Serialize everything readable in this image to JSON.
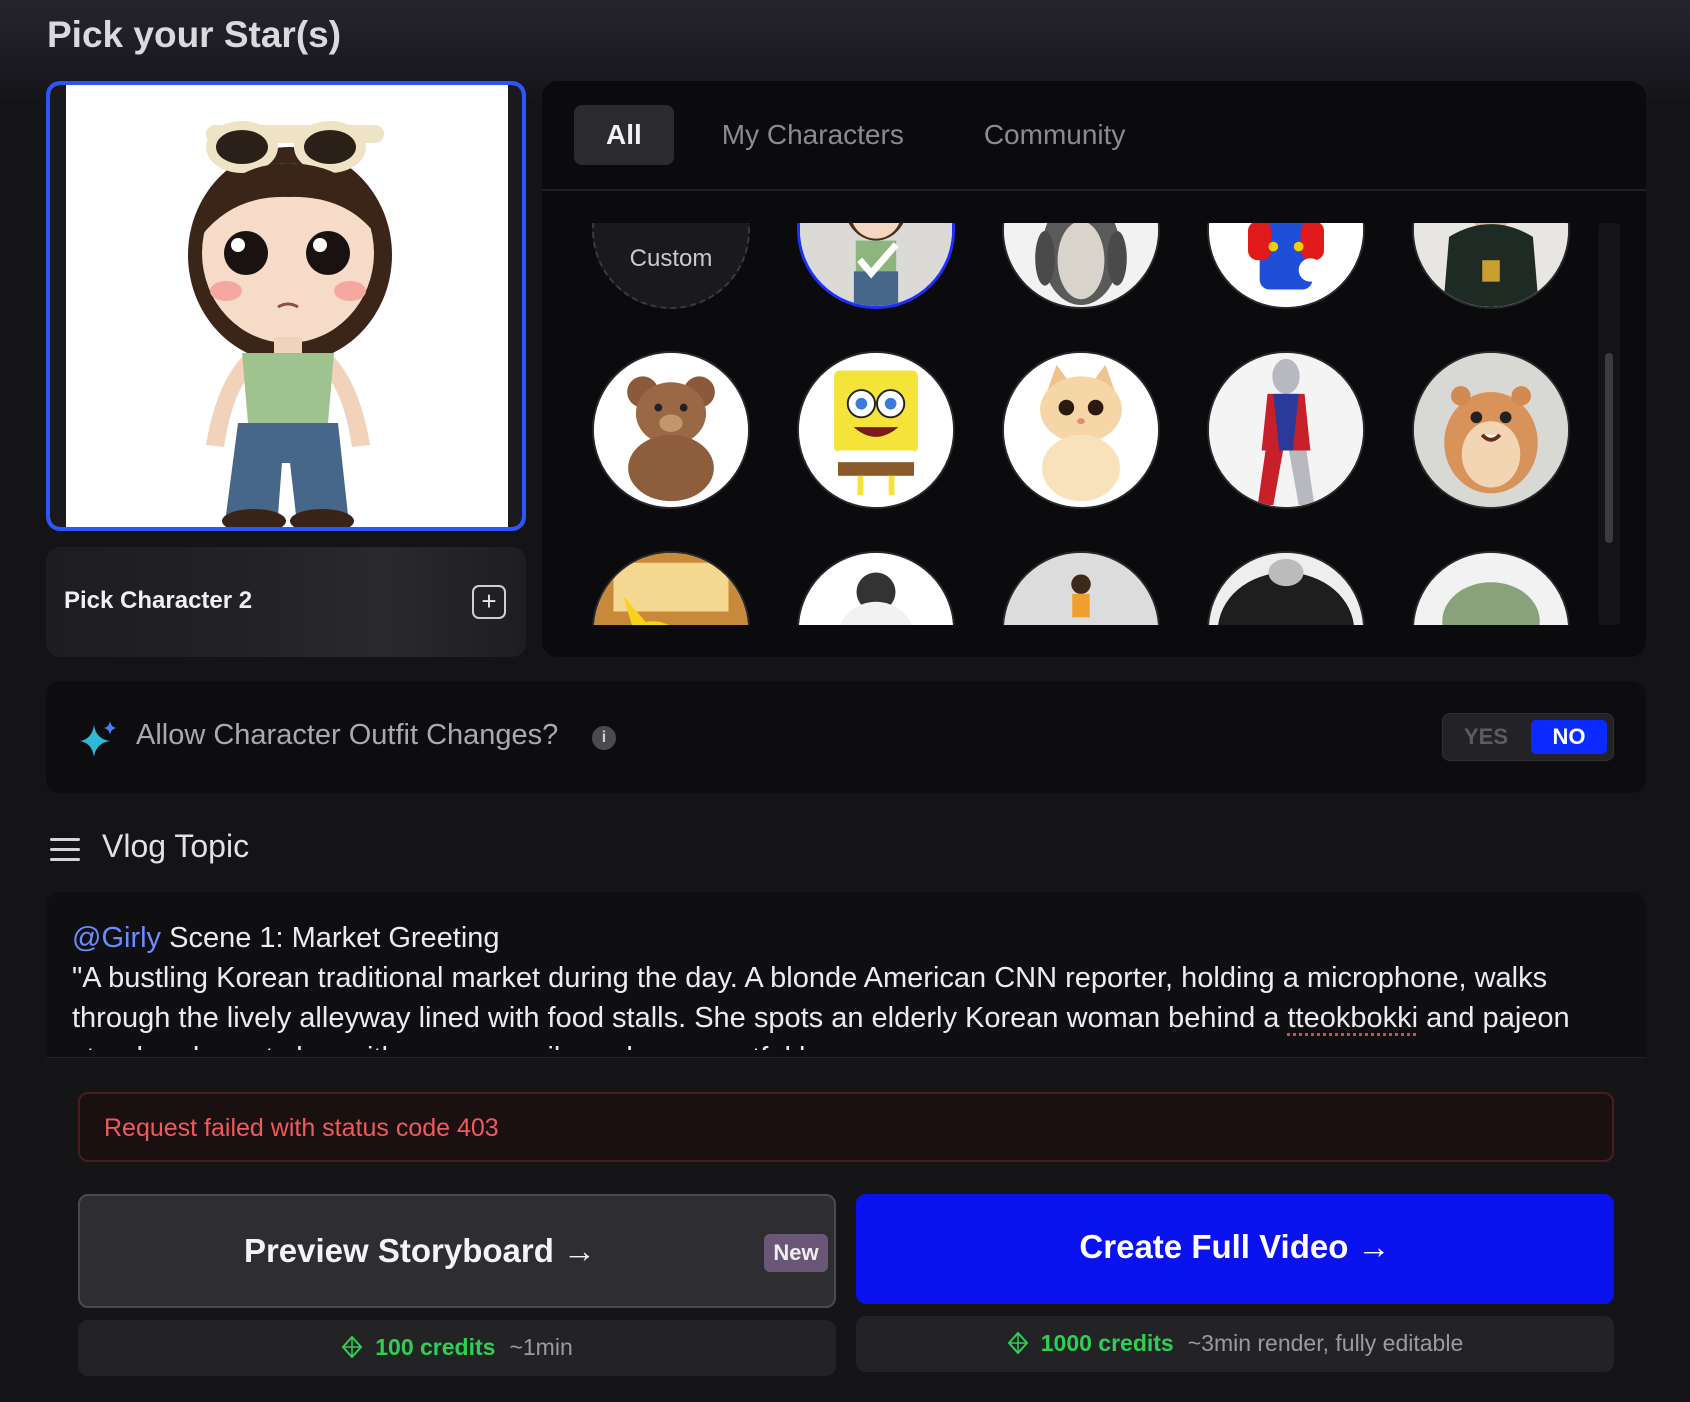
{
  "page": {
    "title": "Pick your Star(s)"
  },
  "selected_star": {
    "name": "Girly"
  },
  "pick_character_2": {
    "label": "Pick Character 2",
    "add_icon": "plus-icon"
  },
  "library": {
    "tabs": [
      {
        "label": "All",
        "active": true
      },
      {
        "label": "My Characters",
        "active": false
      },
      {
        "label": "Community",
        "active": false
      }
    ],
    "custom_label": "Custom",
    "characters": [
      "girly",
      "penguin",
      "plumber",
      "hooded-child",
      "teddy-bear",
      "sponge",
      "kitten",
      "hero",
      "hamster",
      "pikachu",
      "snowbird",
      "doll",
      "masked",
      "frog"
    ],
    "selected": "girly"
  },
  "outfit": {
    "question": "Allow Character Outfit Changes?",
    "info_icon": "info-icon",
    "yes_label": "YES",
    "no_label": "NO",
    "selected": "NO"
  },
  "vlog": {
    "title": "Vlog Topic",
    "mention": "@Girly",
    "scene_title": "Scene 1: Market Greeting",
    "text_before": "\"A bustling Korean traditional market during the day. A blonde American CNN reporter, holding a microphone, walks through the lively alleyway lined with food stalls. She spots an elderly Korean woman behind a ",
    "misspelled_word": "tteokbokki",
    "text_after": " and pajeon stand and greets her with a warm smile and a respectful bow."
  },
  "error": {
    "message": "Request failed with status code 403"
  },
  "actions": {
    "preview_label": "Preview Storyboard →",
    "preview_badge": "New",
    "create_label": "Create Full Video →",
    "preview_credits": "100 credits",
    "preview_time": "~1min",
    "create_credits": "1000 credits",
    "create_time": "~3min render, fully editable"
  },
  "colors": {
    "accent_blue": "#0a12f0",
    "selected_border": "#2a55ff",
    "error_red": "#f05a5a",
    "credit_green": "#2ecf55",
    "mention_blue": "#6c8cff"
  }
}
